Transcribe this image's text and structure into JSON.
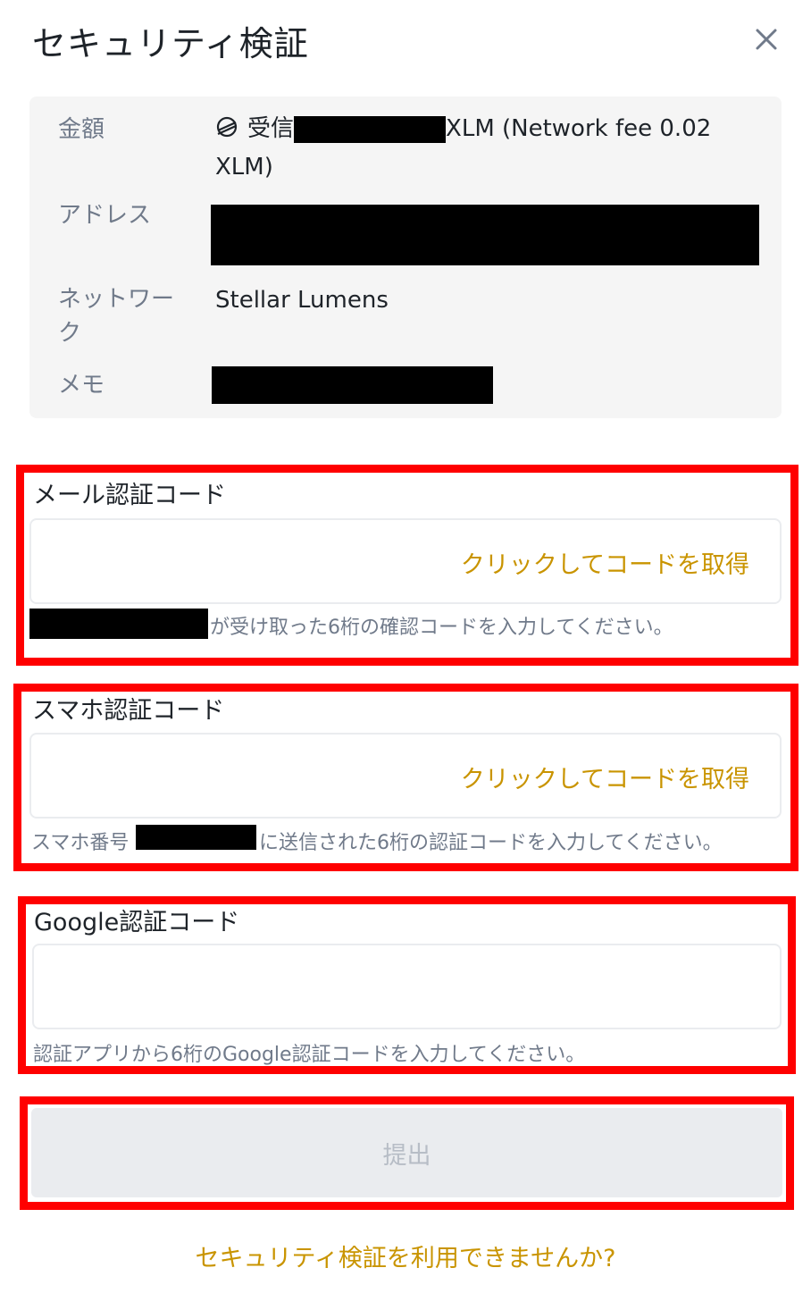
{
  "dialog": {
    "title": "セキュリティ検証",
    "close_icon": "close-icon"
  },
  "summary": {
    "amount_label": "金額",
    "amount_prefix": "受信",
    "amount_suffix": "XLM (Network fee 0.02",
    "amount_suffix_line2": "XLM)",
    "address_label": "アドレス",
    "network_label_line1": "ネットワー",
    "network_label_line2": "ク",
    "network_value": "Stellar Lumens",
    "memo_label": "メモ",
    "coin_icon": "stellar-icon"
  },
  "email_verification": {
    "label": "メール認証コード",
    "get_code": "クリックしてコードを取得",
    "hint": "が受け取った6桁の確認コードを入力してください。"
  },
  "sms_verification": {
    "label": "スマホ認証コード",
    "get_code": "クリックしてコードを取得",
    "hint_prefix": "スマホ番号",
    "hint_suffix": "に送信された6桁の認証コードを入力してください。"
  },
  "google_verification": {
    "label": "Google認証コード",
    "hint": "認証アプリから6桁のGoogle認証コードを入力してください。"
  },
  "submit_label": "提出",
  "footer_link": "セキュリティ検証を利用できませんか?",
  "colors": {
    "accent": "#c99400",
    "highlight": "#ff0000",
    "panel": "#f5f5f5",
    "muted_text": "#707a8a"
  }
}
